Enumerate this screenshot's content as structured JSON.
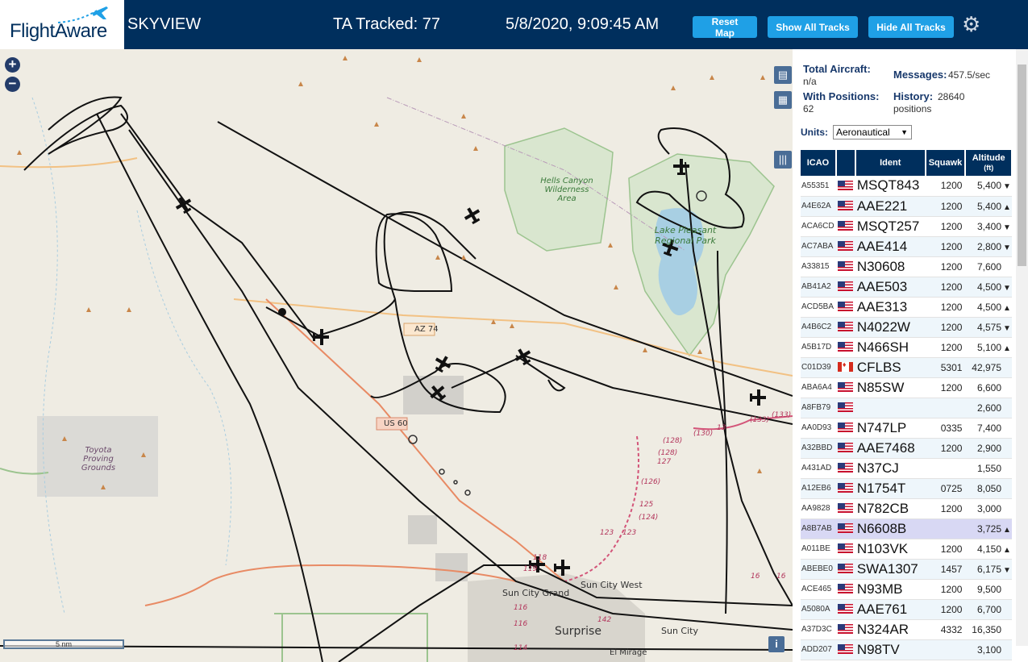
{
  "header": {
    "logo_text": "FlightAware",
    "app_title": "SKYVIEW",
    "tracked": "TA Tracked: 77",
    "datetime": "5/8/2020, 9:09:45 AM",
    "buttons": {
      "reset": "Reset Map",
      "show": "Show All Tracks",
      "hide": "Hide All Tracks"
    },
    "gear_icon": "gear-icon"
  },
  "map": {
    "zoom_in": "+",
    "zoom_out": "−",
    "labels": {
      "hells_canyon": "Hells Canyon Wilderness Area",
      "lake_pleasant": "Lake Pleasant Regional Park",
      "toyota": "Toyota Proving Grounds",
      "az74": "AZ 74",
      "us60": "US 60",
      "sun_city_grand": "Sun City Grand",
      "sun_city_west": "Sun City West",
      "surprise": "Surprise",
      "sun_city": "Sun City",
      "el_mirage": "El Mirage"
    },
    "route_numbers": [
      "(130)",
      "13",
      "(133)",
      "(133)",
      "(128)",
      "(128)",
      "127",
      "(126)",
      "125",
      "(124)",
      "123",
      "123",
      "118",
      "116",
      "116",
      "142",
      "114",
      "119",
      "16",
      "16"
    ],
    "scale": "5 nm",
    "info": "i"
  },
  "stats": {
    "total_label": "Total Aircraft:",
    "total_value": "n/a",
    "messages_label": "Messages:",
    "messages_value": "457.5/sec",
    "positions_label": "With Positions:",
    "positions_value": "62",
    "history_label": "History:",
    "history_value": "28640",
    "history_unit": "positions",
    "units_label": "Units:",
    "units_value": "Aeronautical"
  },
  "table": {
    "headers": {
      "icao": "ICAO",
      "ident": "Ident",
      "squawk": "Squawk",
      "altitude": "Altitude",
      "altitude_unit": "(ft)"
    },
    "rows": [
      {
        "icao": "A55351",
        "flag": "us",
        "ident": "MSQT843",
        "squawk": "1200",
        "alt": "5,400",
        "trend": "▼"
      },
      {
        "icao": "A4E62A",
        "flag": "us",
        "ident": "AAE221",
        "squawk": "1200",
        "alt": "5,400",
        "trend": "▲"
      },
      {
        "icao": "ACA6CD",
        "flag": "us",
        "ident": "MSQT257",
        "squawk": "1200",
        "alt": "3,400",
        "trend": "▼"
      },
      {
        "icao": "AC7ABA",
        "flag": "us",
        "ident": "AAE414",
        "squawk": "1200",
        "alt": "2,800",
        "trend": "▼"
      },
      {
        "icao": "A33815",
        "flag": "us",
        "ident": "N30608",
        "squawk": "1200",
        "alt": "7,600",
        "trend": ""
      },
      {
        "icao": "AB41A2",
        "flag": "us",
        "ident": "AAE503",
        "squawk": "1200",
        "alt": "4,500",
        "trend": "▼"
      },
      {
        "icao": "ACD5BA",
        "flag": "us",
        "ident": "AAE313",
        "squawk": "1200",
        "alt": "4,500",
        "trend": "▲"
      },
      {
        "icao": "A4B6C2",
        "flag": "us",
        "ident": "N4022W",
        "squawk": "1200",
        "alt": "4,575",
        "trend": "▼"
      },
      {
        "icao": "A5B17D",
        "flag": "us",
        "ident": "N466SH",
        "squawk": "1200",
        "alt": "5,100",
        "trend": "▲"
      },
      {
        "icao": "C01D39",
        "flag": "ca",
        "ident": "CFLBS",
        "squawk": "5301",
        "alt": "42,975",
        "trend": ""
      },
      {
        "icao": "ABA6A4",
        "flag": "us",
        "ident": "N85SW",
        "squawk": "1200",
        "alt": "6,600",
        "trend": ""
      },
      {
        "icao": "A8FB79",
        "flag": "us",
        "ident": "",
        "squawk": "",
        "alt": "2,600",
        "trend": ""
      },
      {
        "icao": "AA0D93",
        "flag": "us",
        "ident": "N747LP",
        "squawk": "0335",
        "alt": "7,400",
        "trend": ""
      },
      {
        "icao": "A32BBD",
        "flag": "us",
        "ident": "AAE7468",
        "squawk": "1200",
        "alt": "2,900",
        "trend": ""
      },
      {
        "icao": "A431AD",
        "flag": "us",
        "ident": "N37CJ",
        "squawk": "",
        "alt": "1,550",
        "trend": ""
      },
      {
        "icao": "A12EB6",
        "flag": "us",
        "ident": "N1754T",
        "squawk": "0725",
        "alt": "8,050",
        "trend": ""
      },
      {
        "icao": "AA9828",
        "flag": "us",
        "ident": "N782CB",
        "squawk": "1200",
        "alt": "3,000",
        "trend": ""
      },
      {
        "icao": "A8B7AB",
        "flag": "us",
        "ident": "N6608B",
        "squawk": "",
        "alt": "3,725",
        "trend": "▲",
        "selected": true
      },
      {
        "icao": "A011BE",
        "flag": "us",
        "ident": "N103VK",
        "squawk": "1200",
        "alt": "4,150",
        "trend": "▲"
      },
      {
        "icao": "ABEBE0",
        "flag": "us",
        "ident": "SWA1307",
        "squawk": "1457",
        "alt": "6,175",
        "trend": "▼"
      },
      {
        "icao": "ACE465",
        "flag": "us",
        "ident": "N93MB",
        "squawk": "1200",
        "alt": "9,500",
        "trend": ""
      },
      {
        "icao": "A5080A",
        "flag": "us",
        "ident": "AAE761",
        "squawk": "1200",
        "alt": "6,700",
        "trend": ""
      },
      {
        "icao": "A37D3C",
        "flag": "us",
        "ident": "N324AR",
        "squawk": "4332",
        "alt": "16,350",
        "trend": ""
      },
      {
        "icao": "ADD207",
        "flag": "us",
        "ident": "N98TV",
        "squawk": "",
        "alt": "3,100",
        "trend": ""
      }
    ]
  },
  "colors": {
    "header_bg": "#002f5d",
    "button": "#1fa0e6",
    "map_bg": "#efece3"
  }
}
